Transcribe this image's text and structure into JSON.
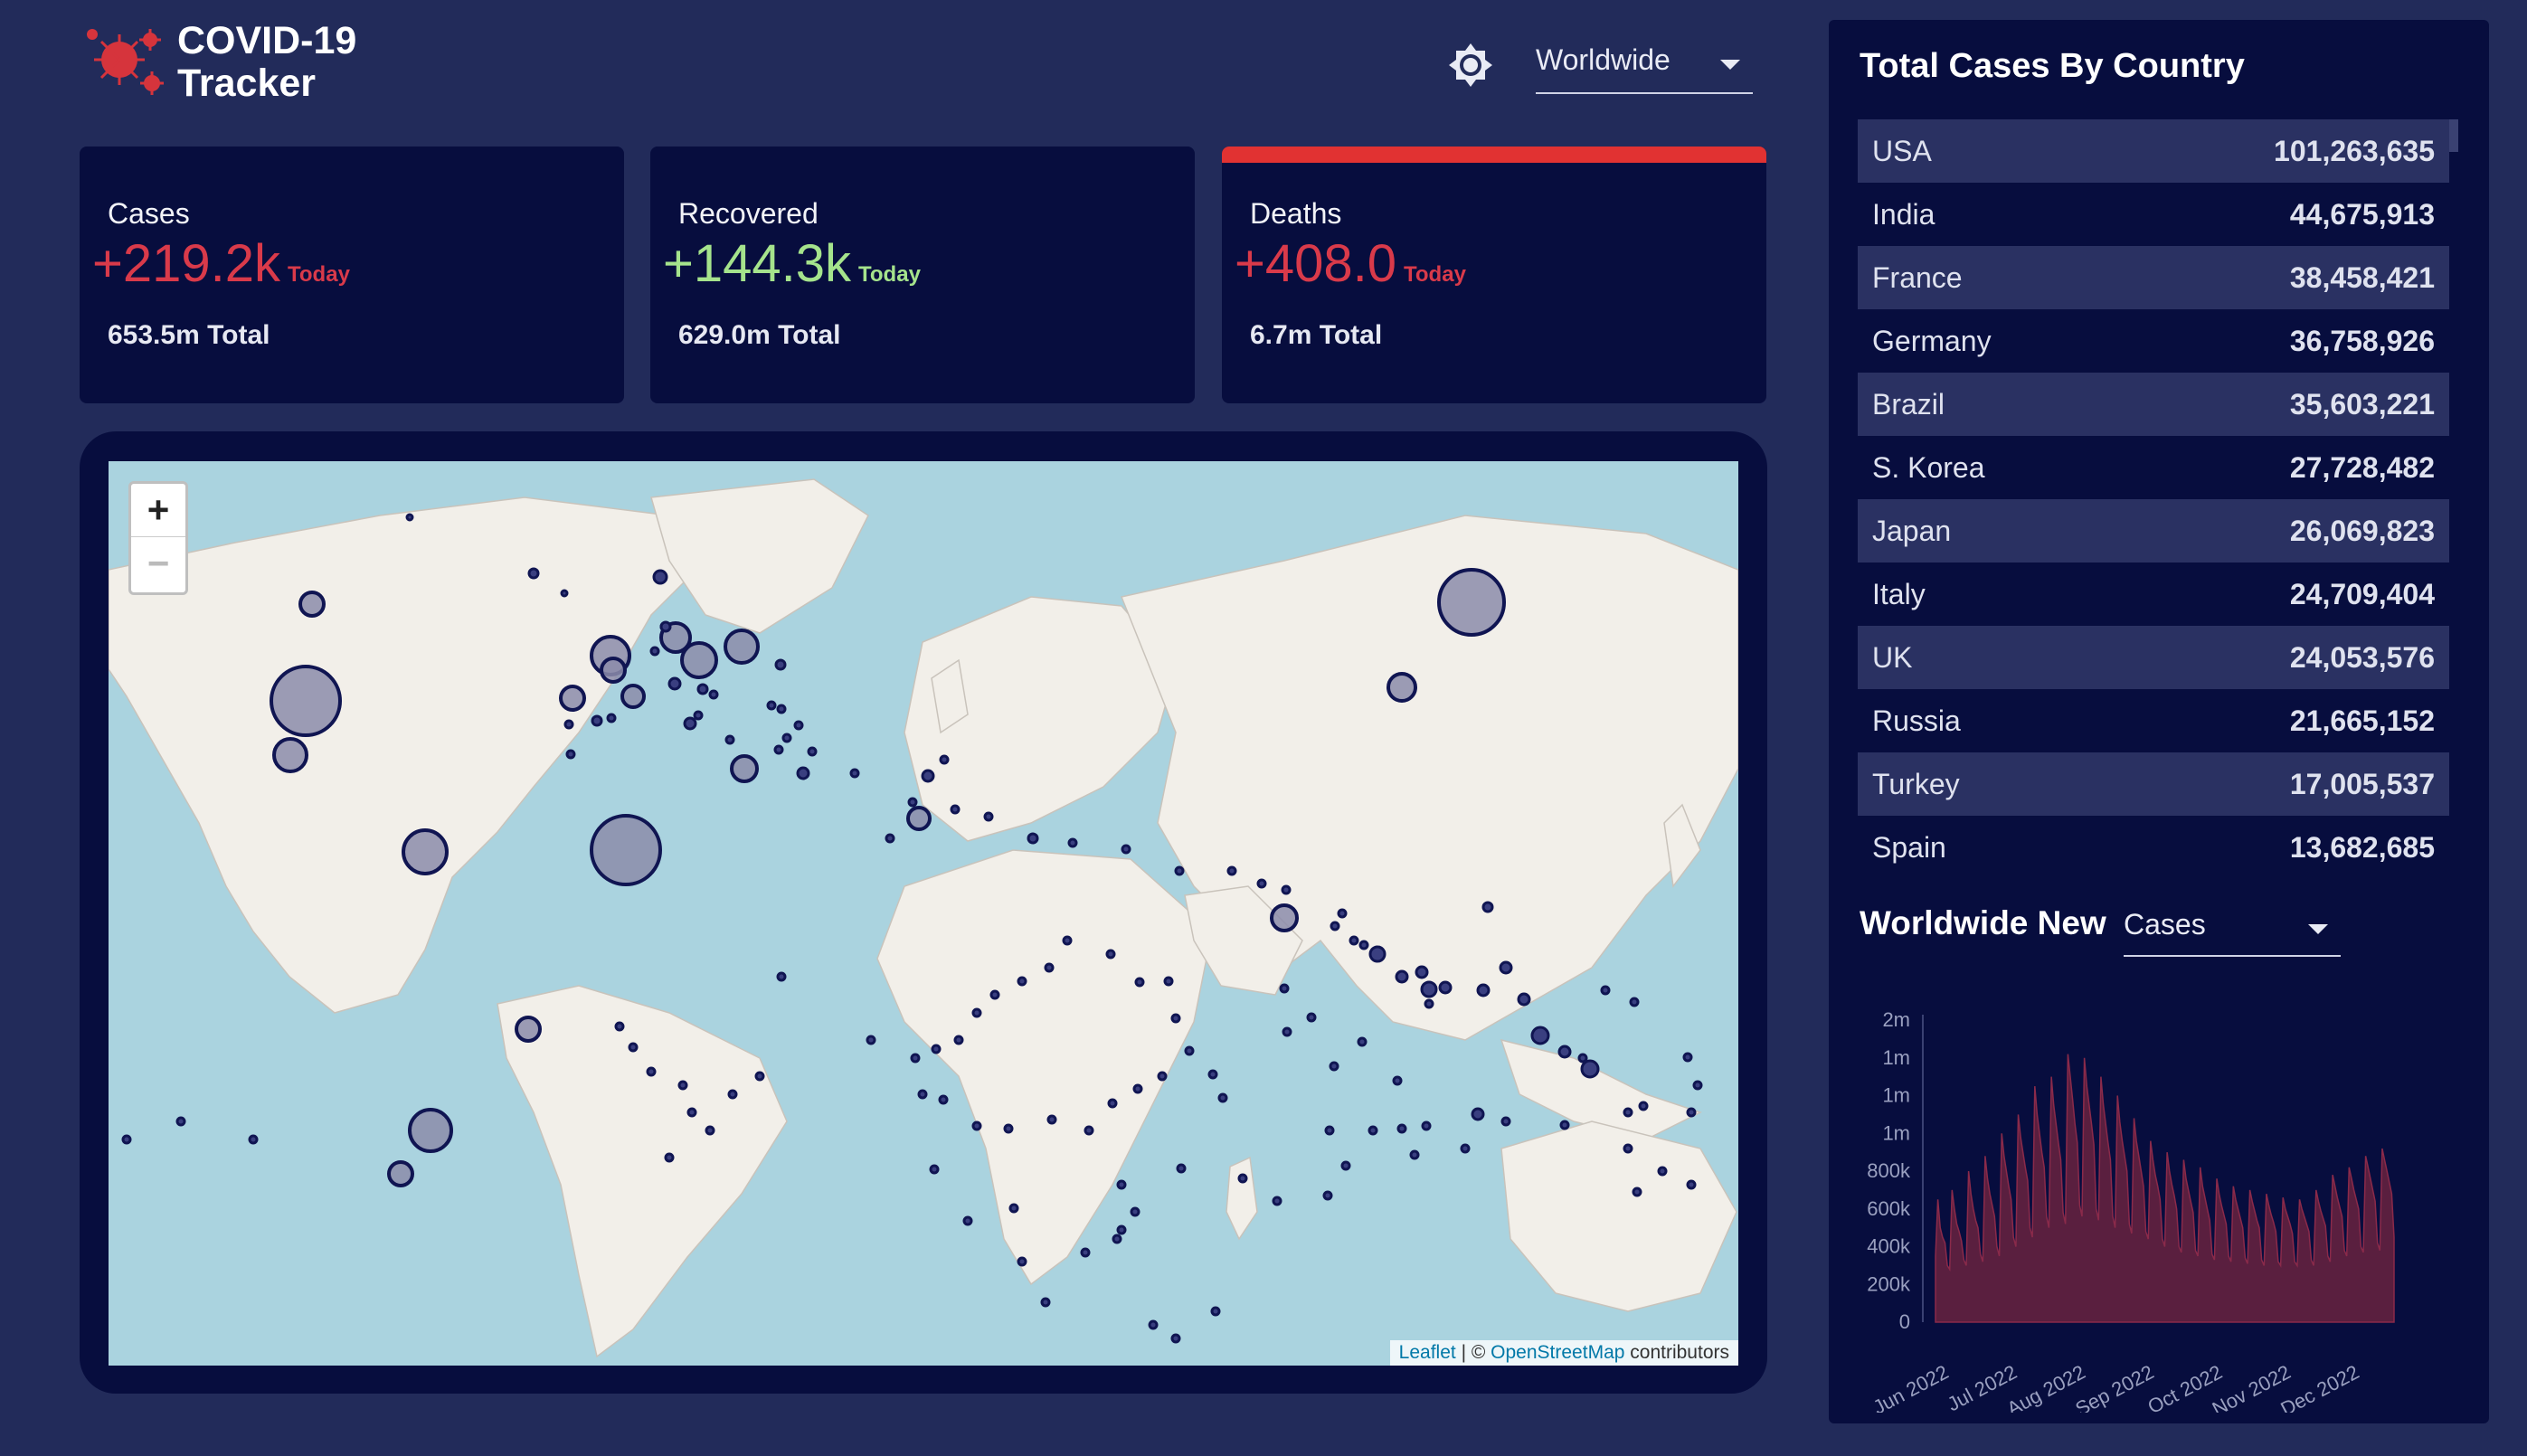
{
  "logo": {
    "line1": "COVID-19",
    "line2": "Tracker"
  },
  "header": {
    "theme_icon": "brightness-icon",
    "region": "Worldwide"
  },
  "cards": [
    {
      "title": "Cases",
      "today": "+219.2k",
      "today_label": "Today",
      "total": "653.5m Total",
      "color": "#d93a4a",
      "selected": false
    },
    {
      "title": "Recovered",
      "today": "+144.3k",
      "today_label": "Today",
      "total": "629.0m Total",
      "color": "#a5e38c",
      "selected": false
    },
    {
      "title": "Deaths",
      "today": "+408.0",
      "today_label": "Today",
      "total": "6.7m Total",
      "color": "#d93a4a",
      "selected": true
    }
  ],
  "map": {
    "zoom_in": "+",
    "zoom_out": "−",
    "attribution_leaflet": "Leaflet",
    "attribution_sep": " | © ",
    "attribution_osm": "OpenStreetMap",
    "attribution_tail": " contributors"
  },
  "sidebar": {
    "title": "Total Cases By Country",
    "rows": [
      {
        "country": "USA",
        "cases": "101,263,635"
      },
      {
        "country": "India",
        "cases": "44,675,913"
      },
      {
        "country": "France",
        "cases": "38,458,421"
      },
      {
        "country": "Germany",
        "cases": "36,758,926"
      },
      {
        "country": "Brazil",
        "cases": "35,603,221"
      },
      {
        "country": "S. Korea",
        "cases": "27,728,482"
      },
      {
        "country": "Japan",
        "cases": "26,069,823"
      },
      {
        "country": "Italy",
        "cases": "24,709,404"
      },
      {
        "country": "UK",
        "cases": "24,053,576"
      },
      {
        "country": "Russia",
        "cases": "21,665,152"
      },
      {
        "country": "Turkey",
        "cases": "17,005,537"
      },
      {
        "country": "Spain",
        "cases": "13,682,685"
      }
    ],
    "new_title": "Worldwide New",
    "new_type": "Cases"
  },
  "chart_data": {
    "type": "area",
    "y_tick_labels": [
      "0",
      "200k",
      "400k",
      "600k",
      "800k",
      "1m",
      "1m",
      "1m",
      "2m"
    ],
    "y_tick_values": [
      0,
      200000,
      400000,
      600000,
      800000,
      1000000,
      1200000,
      1400000,
      1600000
    ],
    "ylim": [
      0,
      1600000
    ],
    "x_tick_labels": [
      "Jun 2022",
      "Jul 2022",
      "Aug 2022",
      "Sep 2022",
      "Oct 2022",
      "Nov 2022",
      "Dec 2022"
    ],
    "color": "#5a1f3f",
    "line_color": "#8a2a4a",
    "series": [
      {
        "values": [
          350000,
          650000,
          500000,
          450000,
          420000,
          300000,
          280000,
          700000,
          600000,
          520000,
          480000,
          430000,
          330000,
          300000,
          800000,
          680000,
          600000,
          540000,
          500000,
          360000,
          320000,
          880000,
          760000,
          680000,
          620000,
          560000,
          400000,
          350000,
          1000000,
          880000,
          800000,
          720000,
          650000,
          450000,
          400000,
          1100000,
          980000,
          900000,
          820000,
          750000,
          500000,
          450000,
          1250000,
          1100000,
          1000000,
          900000,
          820000,
          560000,
          500000,
          1300000,
          1150000,
          1050000,
          950000,
          860000,
          580000,
          520000,
          1420000,
          1300000,
          1180000,
          1050000,
          950000,
          620000,
          560000,
          1400000,
          1250000,
          1150000,
          1050000,
          940000,
          600000,
          540000,
          1300000,
          1150000,
          1050000,
          950000,
          860000,
          560000,
          500000,
          1200000,
          1060000,
          960000,
          880000,
          800000,
          520000,
          470000,
          1080000,
          960000,
          880000,
          800000,
          720000,
          480000,
          440000,
          960000,
          860000,
          780000,
          720000,
          650000,
          440000,
          400000,
          900000,
          800000,
          730000,
          670000,
          600000,
          400000,
          370000,
          860000,
          760000,
          700000,
          640000,
          580000,
          380000,
          350000,
          820000,
          720000,
          660000,
          600000,
          540000,
          360000,
          330000,
          760000,
          680000,
          620000,
          570000,
          520000,
          350000,
          320000,
          720000,
          650000,
          600000,
          550000,
          500000,
          340000,
          310000,
          700000,
          640000,
          590000,
          540000,
          500000,
          330000,
          300000,
          680000,
          620000,
          570000,
          530000,
          480000,
          320000,
          300000,
          660000,
          600000,
          560000,
          520000,
          470000,
          320000,
          300000,
          650000,
          600000,
          560000,
          520000,
          480000,
          330000,
          300000,
          700000,
          640000,
          590000,
          550000,
          510000,
          350000,
          320000,
          780000,
          720000,
          660000,
          610000,
          560000,
          380000,
          350000,
          820000,
          760000,
          700000,
          650000,
          600000,
          400000,
          370000,
          880000,
          820000,
          760000,
          700000,
          640000,
          420000,
          380000,
          920000,
          860000,
          800000,
          740000,
          680000,
          450000
        ]
      }
    ]
  }
}
